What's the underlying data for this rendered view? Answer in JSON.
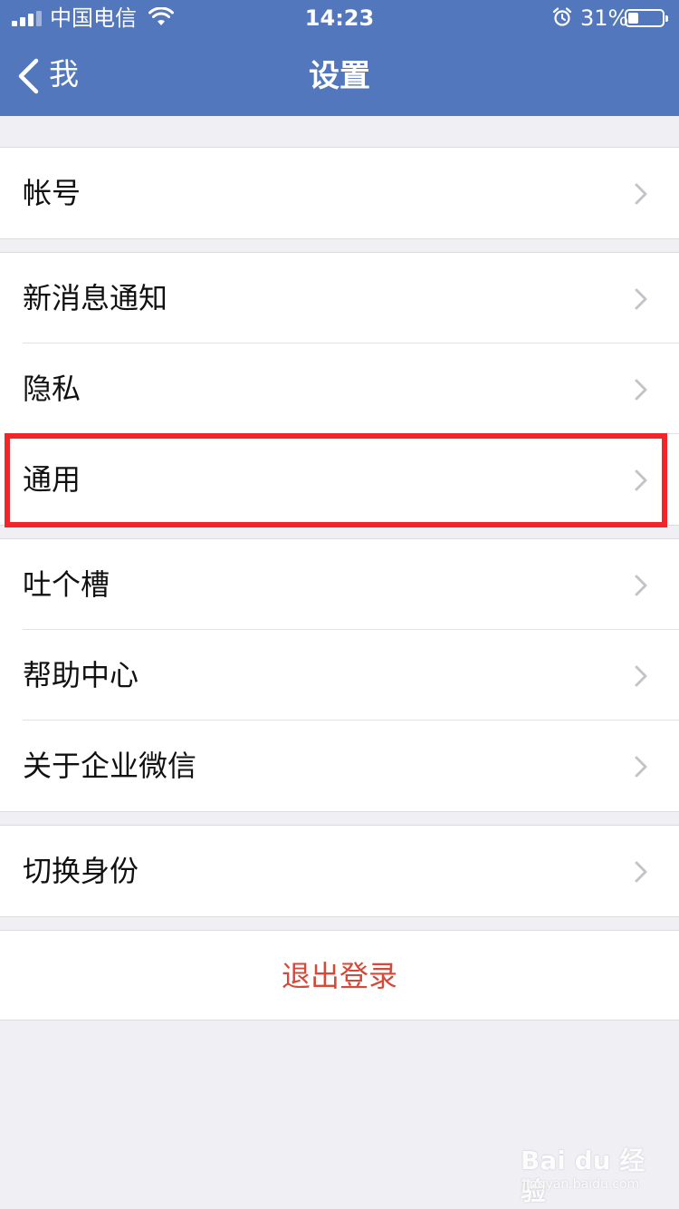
{
  "status_bar": {
    "carrier": "中国电信",
    "time": "14:23",
    "battery_percent": "31%",
    "battery_level": 0.31,
    "icons": [
      "signal-icon",
      "wifi-icon",
      "alarm-icon",
      "battery-icon"
    ]
  },
  "nav": {
    "back_label": "我",
    "title": "设置",
    "back_icon": "chevron-left-icon"
  },
  "groups": [
    {
      "items": [
        {
          "label": "帐号"
        }
      ]
    },
    {
      "items": [
        {
          "label": "新消息通知"
        },
        {
          "label": "隐私"
        },
        {
          "label": "通用",
          "highlighted": true
        }
      ]
    },
    {
      "items": [
        {
          "label": "吐个槽"
        },
        {
          "label": "帮助中心"
        },
        {
          "label": "关于企业微信"
        }
      ]
    },
    {
      "items": [
        {
          "label": "切换身份"
        }
      ]
    }
  ],
  "logout": {
    "label": "退出登录"
  },
  "colors": {
    "header_bg": "#5277bd",
    "page_bg": "#efeff4",
    "logout_text": "#d5493a",
    "highlight_border": "#f0262b"
  },
  "watermark": {
    "text": "Bai du 经验",
    "sub": "jingyan.baidu.com"
  }
}
